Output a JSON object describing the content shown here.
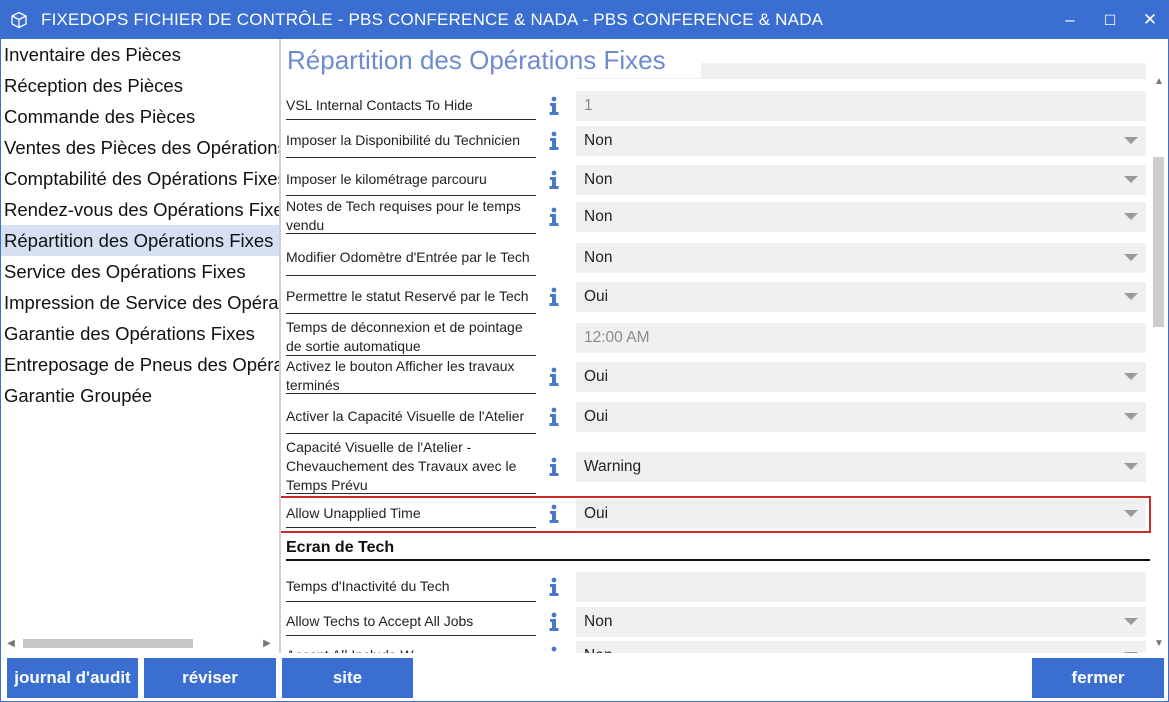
{
  "window": {
    "title": "FIXEDOPS FICHIER DE CONTRÔLE - PBS CONFERENCE & NADA - PBS CONFERENCE & NADA",
    "icon": "cube-icon",
    "minimize": "‒",
    "maximize": "☐",
    "close": "✕"
  },
  "nav": {
    "items": [
      {
        "label": "Inventaire des Pièces"
      },
      {
        "label": "Réception des Pièces"
      },
      {
        "label": "Commande des Pièces"
      },
      {
        "label": "Ventes des Pièces des Opérations Fixes"
      },
      {
        "label": "Comptabilité des Opérations Fixes"
      },
      {
        "label": "Rendez-vous des Opérations Fixes"
      },
      {
        "label": "Répartition des Opérations Fixes",
        "active": true
      },
      {
        "label": "Service des Opérations Fixes"
      },
      {
        "label": "Impression de Service des Opérations Fixes"
      },
      {
        "label": "Garantie des Opérations Fixes"
      },
      {
        "label": "Entreposage de Pneus des Opérations Fixes"
      },
      {
        "label": "Garantie Groupée"
      }
    ]
  },
  "main": {
    "title": "Répartition des Opérations Fixes",
    "fields": [
      {
        "label": "",
        "value": "",
        "info": false,
        "dropdown": false
      },
      {
        "label": "VSL Internal Contacts To Hide",
        "value": "1",
        "info": true,
        "dropdown": false,
        "disabled": true
      },
      {
        "label": "Imposer la Disponibilité du Technicien",
        "value": "Non",
        "info": true,
        "dropdown": true
      },
      {
        "label": "Imposer le kilométrage parcouru",
        "value": "Non",
        "info": true,
        "dropdown": true
      },
      {
        "label": "Notes de Tech requises pour le temps vendu",
        "value": "Non",
        "info": true,
        "dropdown": true
      },
      {
        "label": "Modifier Odomètre d'Entrée par le Tech",
        "value": "Non",
        "info": false,
        "dropdown": true
      },
      {
        "label": "Permettre le statut Reservé par le Tech",
        "value": "Oui",
        "info": true,
        "dropdown": true
      },
      {
        "label": "Temps de déconnexion et de pointage de sortie automatique",
        "value": "12:00 AM",
        "info": false,
        "dropdown": false,
        "disabled": true
      },
      {
        "label": "Activez le bouton Afficher les travaux terminés",
        "value": "Oui",
        "info": true,
        "dropdown": true
      },
      {
        "label": "Activer la Capacité Visuelle de l'Atelier",
        "value": "Oui",
        "info": true,
        "dropdown": true
      },
      {
        "label": "Capacité Visuelle de l'Atelier - Chevauchement des Travaux avec le Temps Prévu",
        "value": "Warning",
        "info": true,
        "dropdown": true
      },
      {
        "label": "Allow Unapplied Time",
        "value": "Oui",
        "info": true,
        "dropdown": true,
        "highlighted": true
      }
    ],
    "section_heading": "Ecran de Tech",
    "tech_fields": [
      {
        "label": "Temps d'Inactivité du Tech",
        "value": "",
        "info": true,
        "dropdown": false
      },
      {
        "label": "Allow Techs to Accept All Jobs",
        "value": "Non",
        "info": true,
        "dropdown": true
      },
      {
        "label": "Accept All Include W",
        "value": "Non",
        "info": true,
        "dropdown": true
      }
    ]
  },
  "buttons": {
    "audit": "journal d'audit",
    "review": "réviser",
    "site": "site",
    "close": "fermer"
  },
  "colors": {
    "accent": "#3a6fd1",
    "title_text": "#6f8bd0",
    "info_icon": "#4a78c8",
    "highlight": "#d22a2a"
  }
}
